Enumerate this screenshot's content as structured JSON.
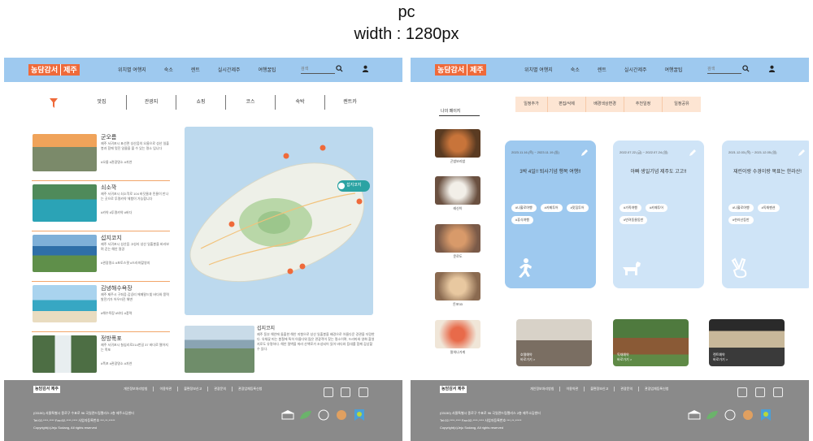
{
  "caption": {
    "device": "pc",
    "width_label": "width : 1280px"
  },
  "brand": {
    "logo_a": "농담감서",
    "logo_b": "제주",
    "footer_logo": "농담감서 제주"
  },
  "nav": {
    "items": [
      "위치별 여행지",
      "숙소",
      "렌트",
      "실시간제주",
      "여행꿀팁"
    ]
  },
  "search": {
    "placeholder": "검색"
  },
  "left": {
    "categories": [
      "맛집",
      "관광지",
      "쇼핑",
      "코스",
      "숙박",
      "렌트카"
    ],
    "places": [
      {
        "title": "군오름",
        "desc": "제주 서귀포시 표선면 성산읍의 오름으로 성산 일출봉과 함께 멋진 일몰을 볼 수 있는 명소 입니다",
        "tags": "#오름  #관광명소  #자연"
      },
      {
        "title": "쇠소깍",
        "desc": "제주 서귀포시 쇠소깍로 104 바닷물과 민물이 만나는 곳으로 투명카약 체험이 가능합니다",
        "tags": "#카약  #투명카약  #바다"
      },
      {
        "title": "섭지코지",
        "desc": "제주 서귀포시 성산읍 고성리 성산 일출봉을 바라보며 걷는 해안 절경",
        "tags": "#관광명소  #포토스팟  #드라마촬영지"
      },
      {
        "title": "김녕해수욕장",
        "desc": "제주 제주시 구좌읍 김녕리 에메랄드빛 바다와 풍력발전기가 어우러진 해변",
        "tags": "#해수욕장  #바다  #풍력"
      },
      {
        "title": "정방폭포",
        "desc": "제주 서귀포시 칠십리로214번길 37 바다로 떨어지는 폭포",
        "tags": "#폭포  #관광명소  #자연"
      }
    ],
    "map": {
      "marker_label": "섭지코지"
    },
    "detail": {
      "title": "섭지코지",
      "text": "제주 동부 해안에 돌출한 해안 지형으로 성산 일출봉을 배경으로 아름다운 경관을 자랑한다. 유채꽃 피는 봄철에 특히 아름다워 많은 관광객이 찾는 명소이며, 드라마와 영화 촬영지로도 유명하다. 해안 절벽을 따라 산책로가 조성되어 있어 바다와 등대를 함께 감상할 수 있다."
    }
  },
  "right": {
    "mypage_title": "나의 페이지",
    "sidebar": [
      "곤밥보리밥",
      "레신이",
      "문로도",
      "돈포33",
      "말의나가게"
    ],
    "tabs": [
      "일정추가",
      "편집/삭제",
      "배경색상변경",
      "추천일정",
      "일정공유"
    ],
    "trips": [
      {
        "date": "2023.11.16.(목) ~ 2023.11.19.(일)",
        "title": "3박 4일!! 퇴사기념 행복 여행!!",
        "tags": [
          "#나홀로여행",
          "#카페투어",
          "#맛집투어",
          "#휴식여행"
        ],
        "icon": "running-icon"
      },
      {
        "date": "2022.07.22.(금) ~ 2022.07.24.(일)",
        "title": "아빠 생일기념 제주도 고고!!",
        "tags": [
          "#가족여행",
          "#카페투어",
          "#반려동물동반"
        ],
        "icon": "dog-icon"
      },
      {
        "date": "2021.12.03.(목) ~ 2021.12.05.(일)",
        "title": "재린이랑 수경이랑 목표는 한라산!",
        "tags": [
          "#나홀로여행",
          "#독채펜션",
          "#한라산등반"
        ],
        "icon": "victory-hand-icon"
      }
    ],
    "recommendations": [
      {
        "line1": "호텔예약",
        "line2": "바로가기 >"
      },
      {
        "line1": "독채예약",
        "line2": "바로가기 >"
      },
      {
        "line1": "렌트예약",
        "line2": "바로가기 >"
      }
    ]
  },
  "footer": {
    "links": [
      "개인정보처리방침",
      "이용약관",
      "불편정보신고",
      "관광문의",
      "관광업체등록신청"
    ],
    "address": "(03150) 서울특별시 종로구 수표로 96 국일관드림팰리스 2층 제주소담센터",
    "contact": "Tel:02-****-**** Fax:02-****-**** 사업자등록번호 ***-**-*****",
    "copyright": "Copyright(c)Jeju Sodang, All rights reserved"
  },
  "colors": {
    "header": "#9ec9ef",
    "accent": "#ef6a3a",
    "footer": "#8a8a8a",
    "tab": "#fde5d3"
  }
}
